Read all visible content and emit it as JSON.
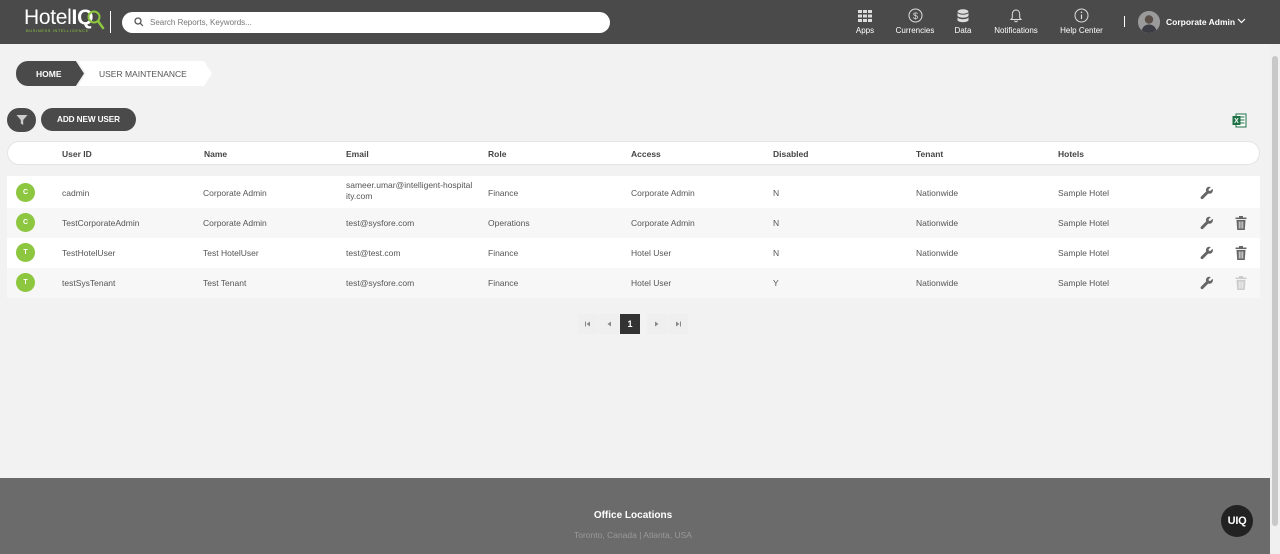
{
  "header": {
    "logo_main": "Hotel",
    "logo_iq": "IQ",
    "logo_sub": "BUSINESS INTELLIGENCE",
    "search_placeholder": "Search Reports, Keywords...",
    "nav": [
      {
        "label": "Apps",
        "icon": "apps-grid-icon"
      },
      {
        "label": "Currencies",
        "icon": "dollar-icon"
      },
      {
        "label": "Data",
        "icon": "database-icon"
      },
      {
        "label": "Notifications",
        "icon": "bell-icon"
      },
      {
        "label": "Help Center",
        "icon": "info-icon"
      }
    ],
    "user_name": "Corporate Admin"
  },
  "breadcrumb": {
    "home": "HOME",
    "current": "USER MAINTENANCE"
  },
  "toolbar": {
    "add_user_label": "ADD NEW USER"
  },
  "table": {
    "columns": [
      "User ID",
      "Name",
      "Email",
      "Role",
      "Access",
      "Disabled",
      "Tenant",
      "Hotels"
    ],
    "rows": [
      {
        "initial": "C",
        "user_id": "cadmin",
        "name": "Corporate Admin",
        "email": "sameer.umar@intelligent-hospitality.com",
        "role": "Finance",
        "access": "Corporate Admin",
        "disabled": "N",
        "tenant": "Nationwide",
        "hotels": "Sample Hotel",
        "deletable": false
      },
      {
        "initial": "C",
        "user_id": "TestCorporateAdmin",
        "name": "Corporate Admin",
        "email": "test@sysfore.com",
        "role": "Operations",
        "access": "Corporate Admin",
        "disabled": "N",
        "tenant": "Nationwide",
        "hotels": "Sample Hotel",
        "deletable": true
      },
      {
        "initial": "T",
        "user_id": "TestHotelUser",
        "name": "Test HotelUser",
        "email": "test@test.com",
        "role": "Finance",
        "access": "Hotel User",
        "disabled": "N",
        "tenant": "Nationwide",
        "hotels": "Sample Hotel",
        "deletable": true
      },
      {
        "initial": "T",
        "user_id": "testSysTenant",
        "name": "Test Tenant",
        "email": "test@sysfore.com",
        "role": "Finance",
        "access": "Hotel User",
        "disabled": "Y",
        "tenant": "Nationwide",
        "hotels": "Sample Hotel",
        "deletable": "disabled"
      }
    ]
  },
  "pagination": {
    "current_page": "1"
  },
  "footer": {
    "title": "Office Locations",
    "locations": "Toronto,  Canada |  Atlanta,  USA"
  },
  "chat_button": "UIQ",
  "colors": {
    "header_bg": "#4a4a4a",
    "accent_green": "#8dc63f",
    "footer_bg": "#6b6b6b"
  }
}
